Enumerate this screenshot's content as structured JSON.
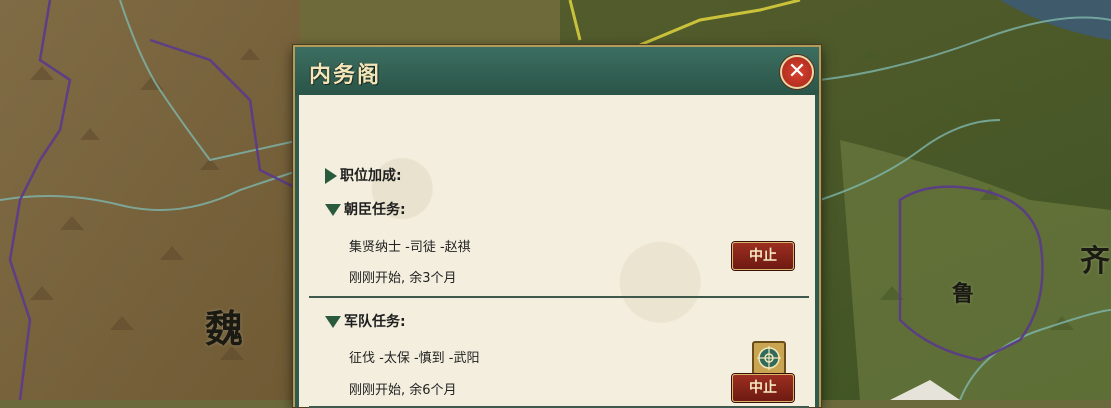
{
  "map": {
    "regions": [
      {
        "name": "wei",
        "label": "魏"
      },
      {
        "name": "lu",
        "label": "鲁"
      },
      {
        "name": "qi",
        "label": "齐"
      }
    ],
    "colors": {
      "west_land": "#7c6a3e",
      "east_land": "#4f5c2c",
      "river": "#7fb6ac",
      "border_purple": "#5b3a8c",
      "border_yellow": "#c9c23a"
    }
  },
  "dialog": {
    "title": "内务阁",
    "close_icon": "close-icon",
    "sections": {
      "position_bonus": {
        "header": "职位加成:",
        "icon": "triangle-right-icon"
      },
      "minister_tasks": {
        "header": "朝臣任务:",
        "icon": "triangle-down-icon",
        "entries": [
          {
            "task": "集贤纳士 -司徒 -赵祺",
            "status": "刚刚开始, 余3个月",
            "button_label": "中止"
          }
        ]
      },
      "army_tasks": {
        "header": "军队任务:",
        "icon": "triangle-down-icon",
        "entries": [
          {
            "task": "征伐 -太保 -慎到 -武阳",
            "status": "刚刚开始, 余6个月",
            "button_label": "中止",
            "icon": "army-target-icon"
          }
        ]
      }
    },
    "colors": {
      "header": "#2f5b4f",
      "body": "#f3eedd",
      "button": "#8a261b",
      "title_text": "#f3e6b8"
    }
  }
}
